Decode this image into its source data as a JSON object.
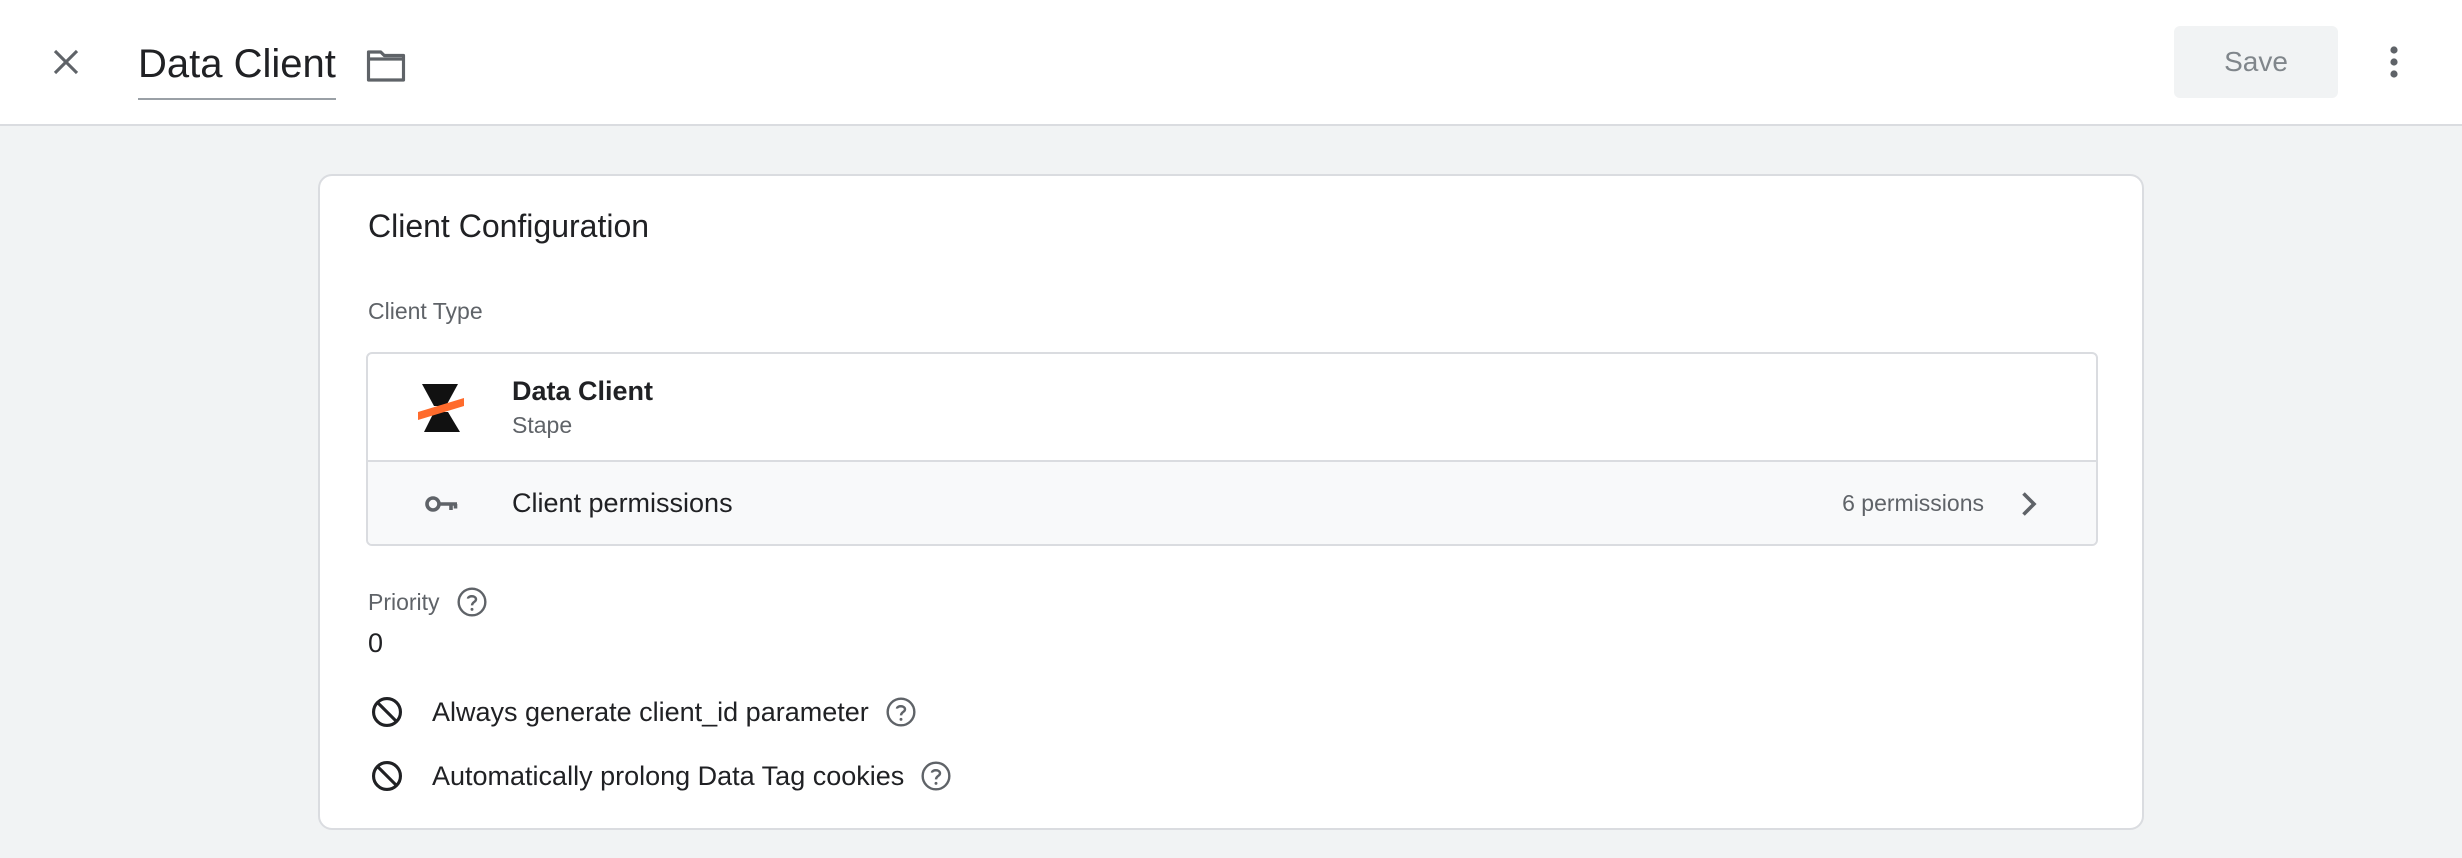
{
  "header": {
    "title": "Data Client",
    "save_label": "Save",
    "icons": {
      "close": "close-icon",
      "folder": "folder-icon",
      "more": "more-vert-icon"
    }
  },
  "card": {
    "title": "Client Configuration",
    "client_type_label": "Client Type",
    "client": {
      "name": "Data Client",
      "vendor": "Stape",
      "logo": "stape-logo"
    },
    "permissions": {
      "label": "Client permissions",
      "count": "6 permissions"
    },
    "priority": {
      "label": "Priority",
      "value": "0"
    },
    "options": [
      {
        "label": "Always generate client_id parameter",
        "state": "disabled"
      },
      {
        "label": "Automatically prolong Data Tag cookies",
        "state": "disabled"
      }
    ]
  },
  "colors": {
    "accent_orange": "#ff6b2c",
    "page_bg": "#f1f3f4",
    "border": "#dadce0"
  }
}
